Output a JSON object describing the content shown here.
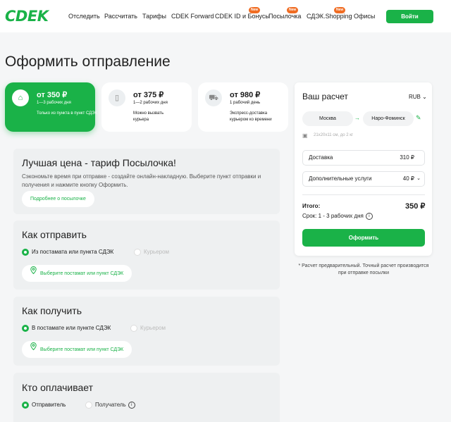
{
  "header": {
    "logo": "CDEK",
    "nav": [
      "Отследить",
      "Рассчитать",
      "Тарифы",
      "CDEK Forward",
      "CDEK ID и Бонусы",
      "Посылочка",
      "СДЭК.Shopping",
      "Офисы"
    ],
    "badge": "New",
    "login": "Войти"
  },
  "page_title": "Оформить отправление",
  "tariffs": [
    {
      "price": "от 350 ₽",
      "days": "1—3 рабочих дня",
      "note": "Только из пункта в пункт СДЭК",
      "icon": "home-icon"
    },
    {
      "price": "от 375 ₽",
      "days": "1—2 рабочих дня",
      "note": "Можно вызвать курьера",
      "icon": "door-icon"
    },
    {
      "price": "от 980 ₽",
      "days": "1 рабочий день",
      "note": "Экспресс-доставка курьером ко времени",
      "icon": "truck-icon"
    }
  ],
  "promo": {
    "title": "Лучшая цена - тариф Посылочка!",
    "text": "Сэкономьте время при отправке - создайте онлайн-накладную. Выберите пункт отправки и получения и нажмите кнопку Оформить.",
    "more": "Подробнее о посылочке"
  },
  "send": {
    "title": "Как отправить",
    "opt1": "Из постамата или пункта СДЭК",
    "opt2": "Курьером",
    "pick": "Выберите постамат или пункт СДЭК"
  },
  "receive": {
    "title": "Как получить",
    "opt1": "В постамате или пункте СДЭК",
    "opt2": "Курьером",
    "pick": "Выберите постамат или пункт СДЭК"
  },
  "payer": {
    "title": "Кто оплачивает",
    "opt1": "Отправитель",
    "opt2": "Получатель"
  },
  "calc": {
    "title": "Ваш расчет",
    "currency": "RUB",
    "from": "Москва",
    "to": "Наро-Фоминск",
    "package": "21x20x11 см, до 2 кг",
    "delivery_label": "Доставка",
    "delivery_value": "310 ₽",
    "extra_label": "Дополнительные услуги",
    "extra_value": "40 ₽",
    "total_label": "Итого:",
    "total_value": "350 ₽",
    "term": "Срок: 1 - 3 рабочих дня",
    "order": "Оформить"
  },
  "footnote": "* Расчет предварительный. Точный расчет производится при отправке посылки",
  "colors": {
    "accent": "#1ab248",
    "badge": "#f06c22"
  }
}
